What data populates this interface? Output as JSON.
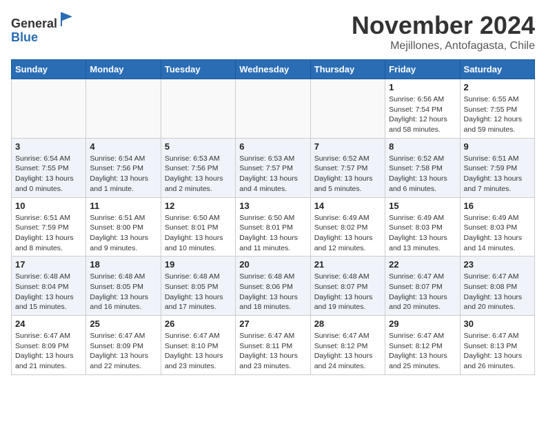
{
  "header": {
    "logo_line1": "General",
    "logo_line2": "Blue",
    "month_title": "November 2024",
    "subtitle": "Mejillones, Antofagasta, Chile"
  },
  "weekdays": [
    "Sunday",
    "Monday",
    "Tuesday",
    "Wednesday",
    "Thursday",
    "Friday",
    "Saturday"
  ],
  "weeks": [
    [
      {
        "day": "",
        "info": ""
      },
      {
        "day": "",
        "info": ""
      },
      {
        "day": "",
        "info": ""
      },
      {
        "day": "",
        "info": ""
      },
      {
        "day": "",
        "info": ""
      },
      {
        "day": "1",
        "info": "Sunrise: 6:56 AM\nSunset: 7:54 PM\nDaylight: 12 hours and 58 minutes."
      },
      {
        "day": "2",
        "info": "Sunrise: 6:55 AM\nSunset: 7:55 PM\nDaylight: 12 hours and 59 minutes."
      }
    ],
    [
      {
        "day": "3",
        "info": "Sunrise: 6:54 AM\nSunset: 7:55 PM\nDaylight: 13 hours and 0 minutes."
      },
      {
        "day": "4",
        "info": "Sunrise: 6:54 AM\nSunset: 7:56 PM\nDaylight: 13 hours and 1 minute."
      },
      {
        "day": "5",
        "info": "Sunrise: 6:53 AM\nSunset: 7:56 PM\nDaylight: 13 hours and 2 minutes."
      },
      {
        "day": "6",
        "info": "Sunrise: 6:53 AM\nSunset: 7:57 PM\nDaylight: 13 hours and 4 minutes."
      },
      {
        "day": "7",
        "info": "Sunrise: 6:52 AM\nSunset: 7:57 PM\nDaylight: 13 hours and 5 minutes."
      },
      {
        "day": "8",
        "info": "Sunrise: 6:52 AM\nSunset: 7:58 PM\nDaylight: 13 hours and 6 minutes."
      },
      {
        "day": "9",
        "info": "Sunrise: 6:51 AM\nSunset: 7:59 PM\nDaylight: 13 hours and 7 minutes."
      }
    ],
    [
      {
        "day": "10",
        "info": "Sunrise: 6:51 AM\nSunset: 7:59 PM\nDaylight: 13 hours and 8 minutes."
      },
      {
        "day": "11",
        "info": "Sunrise: 6:51 AM\nSunset: 8:00 PM\nDaylight: 13 hours and 9 minutes."
      },
      {
        "day": "12",
        "info": "Sunrise: 6:50 AM\nSunset: 8:01 PM\nDaylight: 13 hours and 10 minutes."
      },
      {
        "day": "13",
        "info": "Sunrise: 6:50 AM\nSunset: 8:01 PM\nDaylight: 13 hours and 11 minutes."
      },
      {
        "day": "14",
        "info": "Sunrise: 6:49 AM\nSunset: 8:02 PM\nDaylight: 13 hours and 12 minutes."
      },
      {
        "day": "15",
        "info": "Sunrise: 6:49 AM\nSunset: 8:03 PM\nDaylight: 13 hours and 13 minutes."
      },
      {
        "day": "16",
        "info": "Sunrise: 6:49 AM\nSunset: 8:03 PM\nDaylight: 13 hours and 14 minutes."
      }
    ],
    [
      {
        "day": "17",
        "info": "Sunrise: 6:48 AM\nSunset: 8:04 PM\nDaylight: 13 hours and 15 minutes."
      },
      {
        "day": "18",
        "info": "Sunrise: 6:48 AM\nSunset: 8:05 PM\nDaylight: 13 hours and 16 minutes."
      },
      {
        "day": "19",
        "info": "Sunrise: 6:48 AM\nSunset: 8:05 PM\nDaylight: 13 hours and 17 minutes."
      },
      {
        "day": "20",
        "info": "Sunrise: 6:48 AM\nSunset: 8:06 PM\nDaylight: 13 hours and 18 minutes."
      },
      {
        "day": "21",
        "info": "Sunrise: 6:48 AM\nSunset: 8:07 PM\nDaylight: 13 hours and 19 minutes."
      },
      {
        "day": "22",
        "info": "Sunrise: 6:47 AM\nSunset: 8:07 PM\nDaylight: 13 hours and 20 minutes."
      },
      {
        "day": "23",
        "info": "Sunrise: 6:47 AM\nSunset: 8:08 PM\nDaylight: 13 hours and 20 minutes."
      }
    ],
    [
      {
        "day": "24",
        "info": "Sunrise: 6:47 AM\nSunset: 8:09 PM\nDaylight: 13 hours and 21 minutes."
      },
      {
        "day": "25",
        "info": "Sunrise: 6:47 AM\nSunset: 8:09 PM\nDaylight: 13 hours and 22 minutes."
      },
      {
        "day": "26",
        "info": "Sunrise: 6:47 AM\nSunset: 8:10 PM\nDaylight: 13 hours and 23 minutes."
      },
      {
        "day": "27",
        "info": "Sunrise: 6:47 AM\nSunset: 8:11 PM\nDaylight: 13 hours and 23 minutes."
      },
      {
        "day": "28",
        "info": "Sunrise: 6:47 AM\nSunset: 8:12 PM\nDaylight: 13 hours and 24 minutes."
      },
      {
        "day": "29",
        "info": "Sunrise: 6:47 AM\nSunset: 8:12 PM\nDaylight: 13 hours and 25 minutes."
      },
      {
        "day": "30",
        "info": "Sunrise: 6:47 AM\nSunset: 8:13 PM\nDaylight: 13 hours and 26 minutes."
      }
    ]
  ]
}
